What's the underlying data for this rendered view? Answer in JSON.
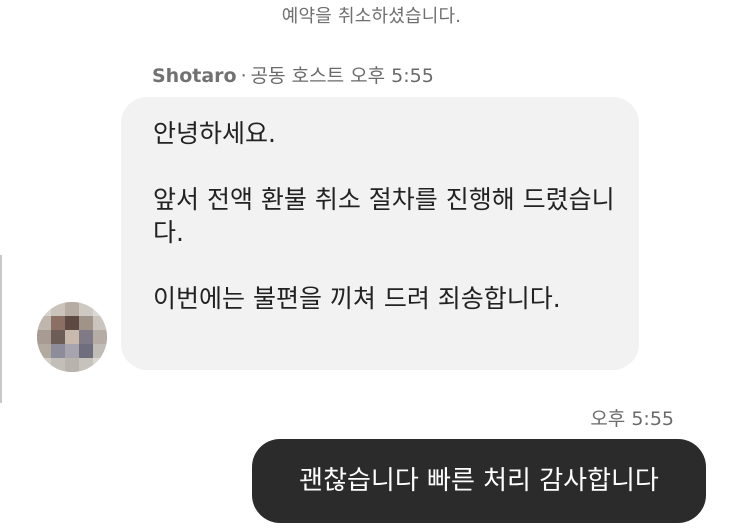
{
  "system_message": "예약을 취소하셨습니다.",
  "incoming": {
    "sender_name": "Shotaro",
    "separator": "·",
    "role": "공동 호스트",
    "time": "오후 5:55",
    "paragraphs": [
      "안녕하세요.",
      "앞서 전액 환불 취소 절차를 진행해 드렸습니다.",
      "이번에는 불편을 끼쳐 드려 죄송합니다."
    ]
  },
  "outgoing": {
    "time": "오후 5:55",
    "text": "괜찮습니다 빠른 처리 감사합니다"
  },
  "colors": {
    "incoming_bubble": "#f2f2f2",
    "outgoing_bubble": "#2b2b2b",
    "meta_text": "#6a6a6a"
  }
}
